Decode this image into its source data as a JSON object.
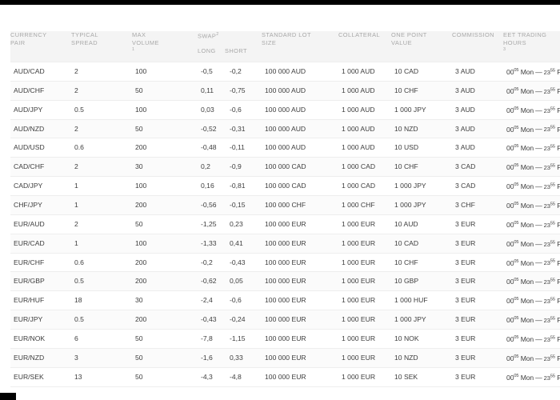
{
  "table": {
    "headers": {
      "currency_pair": "CURRENCY\nPAIR",
      "typical_spread": "TYPICAL\nSPREAD",
      "max_volume": "MAX\nVOLUME",
      "max_volume_note": "1",
      "swap": "SWAP",
      "swap_note": "2",
      "swap_long": "LONG",
      "swap_short": "SHORT",
      "standard_lot_size": "STANDARD LOT\nSIZE",
      "collateral": "COLLATERAL",
      "one_point_value": "ONE POINT\nVALUE",
      "commission": "COMMISSION",
      "eet_trading_hours": "EET TRADING\nHOURS",
      "eet_trading_hours_note": "3"
    },
    "hours_common": {
      "start": "00",
      "start_sup": "05",
      "start_day": "Mon",
      "dash": "—",
      "end": "23",
      "end_sup": "55",
      "end_day": "Fri"
    },
    "rows": [
      {
        "pair": "AUD/CAD",
        "spread": "2",
        "volume": "100",
        "swap_long": "-0,5",
        "swap_short": "-0,2",
        "lot": "100 000 AUD",
        "collateral": "1 000 AUD",
        "one_point": "10 CAD",
        "commission": "3 AUD"
      },
      {
        "pair": "AUD/CHF",
        "spread": "2",
        "volume": "50",
        "swap_long": "0,11",
        "swap_short": "-0,75",
        "lot": "100 000 AUD",
        "collateral": "1 000 AUD",
        "one_point": "10 CHF",
        "commission": "3 AUD"
      },
      {
        "pair": "AUD/JPY",
        "spread": "0.5",
        "volume": "100",
        "swap_long": "0,03",
        "swap_short": "-0,6",
        "lot": "100 000 AUD",
        "collateral": "1 000 AUD",
        "one_point": "1 000 JPY",
        "commission": "3 AUD"
      },
      {
        "pair": "AUD/NZD",
        "spread": "2",
        "volume": "50",
        "swap_long": "-0,52",
        "swap_short": "-0,31",
        "lot": "100 000 AUD",
        "collateral": "1 000 AUD",
        "one_point": "10 NZD",
        "commission": "3 AUD"
      },
      {
        "pair": "AUD/USD",
        "spread": "0.6",
        "volume": "200",
        "swap_long": "-0,48",
        "swap_short": "-0,11",
        "lot": "100 000 AUD",
        "collateral": "1 000 AUD",
        "one_point": "10 USD",
        "commission": "3 AUD"
      },
      {
        "pair": "CAD/CHF",
        "spread": "2",
        "volume": "30",
        "swap_long": "0,2",
        "swap_short": "-0,9",
        "lot": "100 000 CAD",
        "collateral": "1 000 CAD",
        "one_point": "10 CHF",
        "commission": "3 CAD"
      },
      {
        "pair": "CAD/JPY",
        "spread": "1",
        "volume": "100",
        "swap_long": "0,16",
        "swap_short": "-0,81",
        "lot": "100 000 CAD",
        "collateral": "1 000 CAD",
        "one_point": "1 000 JPY",
        "commission": "3 CAD"
      },
      {
        "pair": "CHF/JPY",
        "spread": "1",
        "volume": "200",
        "swap_long": "-0,56",
        "swap_short": "-0,15",
        "lot": "100 000 CHF",
        "collateral": "1 000 CHF",
        "one_point": "1 000 JPY",
        "commission": "3 CHF"
      },
      {
        "pair": "EUR/AUD",
        "spread": "2",
        "volume": "50",
        "swap_long": "-1,25",
        "swap_short": "0,23",
        "lot": "100 000 EUR",
        "collateral": "1 000 EUR",
        "one_point": "10 AUD",
        "commission": "3 EUR"
      },
      {
        "pair": "EUR/CAD",
        "spread": "1",
        "volume": "100",
        "swap_long": "-1,33",
        "swap_short": "0,41",
        "lot": "100 000 EUR",
        "collateral": "1 000 EUR",
        "one_point": "10 CAD",
        "commission": "3 EUR"
      },
      {
        "pair": "EUR/CHF",
        "spread": "0.6",
        "volume": "200",
        "swap_long": "-0,2",
        "swap_short": "-0,43",
        "lot": "100 000 EUR",
        "collateral": "1 000 EUR",
        "one_point": "10 CHF",
        "commission": "3 EUR"
      },
      {
        "pair": "EUR/GBP",
        "spread": "0.5",
        "volume": "200",
        "swap_long": "-0,62",
        "swap_short": "0,05",
        "lot": "100 000 EUR",
        "collateral": "1 000 EUR",
        "one_point": "10 GBP",
        "commission": "3 EUR"
      },
      {
        "pair": "EUR/HUF",
        "spread": "18",
        "volume": "30",
        "swap_long": "-2,4",
        "swap_short": "-0,6",
        "lot": "100 000 EUR",
        "collateral": "1 000 EUR",
        "one_point": "1 000 HUF",
        "commission": "3 EUR"
      },
      {
        "pair": "EUR/JPY",
        "spread": "0.5",
        "volume": "200",
        "swap_long": "-0,43",
        "swap_short": "-0,24",
        "lot": "100 000 EUR",
        "collateral": "1 000 EUR",
        "one_point": "1 000 JPY",
        "commission": "3 EUR"
      },
      {
        "pair": "EUR/NOK",
        "spread": "6",
        "volume": "50",
        "swap_long": "-7,8",
        "swap_short": "-1,15",
        "lot": "100 000 EUR",
        "collateral": "1 000 EUR",
        "one_point": "10 NOK",
        "commission": "3 EUR"
      },
      {
        "pair": "EUR/NZD",
        "spread": "3",
        "volume": "50",
        "swap_long": "-1,6",
        "swap_short": "0,33",
        "lot": "100 000 EUR",
        "collateral": "1 000 EUR",
        "one_point": "10 NZD",
        "commission": "3 EUR"
      },
      {
        "pair": "EUR/SEK",
        "spread": "13",
        "volume": "50",
        "swap_long": "-4,3",
        "swap_short": "-4,8",
        "lot": "100 000 EUR",
        "collateral": "1 000 EUR",
        "one_point": "10 SEK",
        "commission": "3 EUR"
      }
    ]
  },
  "colors": {
    "header_bg": "#f4f4f4",
    "header_text": "#a8a8a8",
    "body_text": "#3d3d3d",
    "row_border": "#eeeeee",
    "alt_row_bg": "#fbfbfb"
  }
}
